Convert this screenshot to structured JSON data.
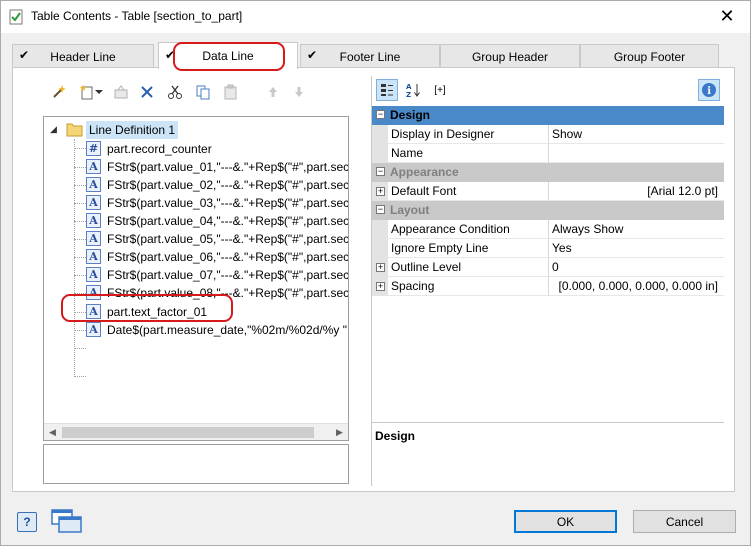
{
  "window": {
    "title": "Table Contents - Table [section_to_part]",
    "close_label": "✕"
  },
  "tabs": [
    {
      "label": "Header Line",
      "checked": true,
      "active": false
    },
    {
      "label": "Data Line",
      "checked": true,
      "active": true
    },
    {
      "label": "Footer Line",
      "checked": true,
      "active": false
    },
    {
      "label": "Group Header",
      "checked": false,
      "active": false
    },
    {
      "label": "Group Footer",
      "checked": false,
      "active": false
    }
  ],
  "tab_check_glyph": "✔",
  "toolbar": {
    "icons": [
      "wand-icon",
      "new-item-icon",
      "dropdown-arrow-icon",
      "properties-icon",
      "delete-icon",
      "cut-icon",
      "copy-icon",
      "paste-icon",
      "move-up-icon",
      "move-down-icon"
    ]
  },
  "tree": {
    "root": {
      "label": "Line Definition  1",
      "toggle": "◢"
    },
    "items": [
      {
        "icon": "#",
        "label": "part.record_counter"
      },
      {
        "icon": "A",
        "label": "FStr$(part.value_01,\"---&.\"+Rep$(\"#\",part.sec"
      },
      {
        "icon": "A",
        "label": "FStr$(part.value_02,\"---&.\"+Rep$(\"#\",part.sec"
      },
      {
        "icon": "A",
        "label": "FStr$(part.value_03,\"---&.\"+Rep$(\"#\",part.sec"
      },
      {
        "icon": "A",
        "label": "FStr$(part.value_04,\"---&.\"+Rep$(\"#\",part.sec"
      },
      {
        "icon": "A",
        "label": "FStr$(part.value_05,\"---&.\"+Rep$(\"#\",part.sec"
      },
      {
        "icon": "A",
        "label": "FStr$(part.value_06,\"---&.\"+Rep$(\"#\",part.sec"
      },
      {
        "icon": "A",
        "label": "FStr$(part.value_07,\"---&.\"+Rep$(\"#\",part.sec"
      },
      {
        "icon": "A",
        "label": "FStr$(part.value_08,\"---&.\"+Rep$(\"#\",part.sec"
      },
      {
        "icon": "A",
        "label": "part.text_factor_01"
      },
      {
        "icon": "A",
        "label": "Date$(part.measure_date,\"%02m/%02d/%y  \","
      }
    ],
    "scroll_left": "◀",
    "scroll_right": "▶"
  },
  "props_toolbar": {
    "icons": [
      "categorized-icon",
      "sort-az-icon",
      "expand-all-icon",
      "info-icon"
    ],
    "expand_label": "[+]",
    "info_label": "i"
  },
  "properties": {
    "categories": [
      {
        "label": "Design",
        "toggle": "−",
        "rows": [
          {
            "name": "Display in Designer",
            "value": "Show",
            "expandable": false
          },
          {
            "name": "Name",
            "value": "",
            "expandable": false
          }
        ]
      },
      {
        "label": "Appearance",
        "toggle": "−",
        "rows": [
          {
            "name": "Default Font",
            "value": "[Arial 12.0 pt]",
            "expandable": true
          }
        ]
      },
      {
        "label": "Layout",
        "toggle": "−",
        "rows": [
          {
            "name": "Appearance Condition",
            "value": "Always Show",
            "expandable": false
          },
          {
            "name": "Ignore Empty Line",
            "value": "Yes",
            "expandable": false
          },
          {
            "name": "Outline Level",
            "value": "0",
            "expandable": true
          },
          {
            "name": "Spacing",
            "value": "[0.000, 0.000, 0.000, 0.000 in]",
            "expandable": true
          }
        ]
      }
    ],
    "expand_glyph": "+",
    "description_title": "Design"
  },
  "buttons": {
    "help": "?",
    "ok": "OK",
    "cancel": "Cancel"
  },
  "colors": {
    "selected_category": "#4a89c8",
    "highlight_red": "#d7191c",
    "tree_selection": "#cce4f7"
  }
}
